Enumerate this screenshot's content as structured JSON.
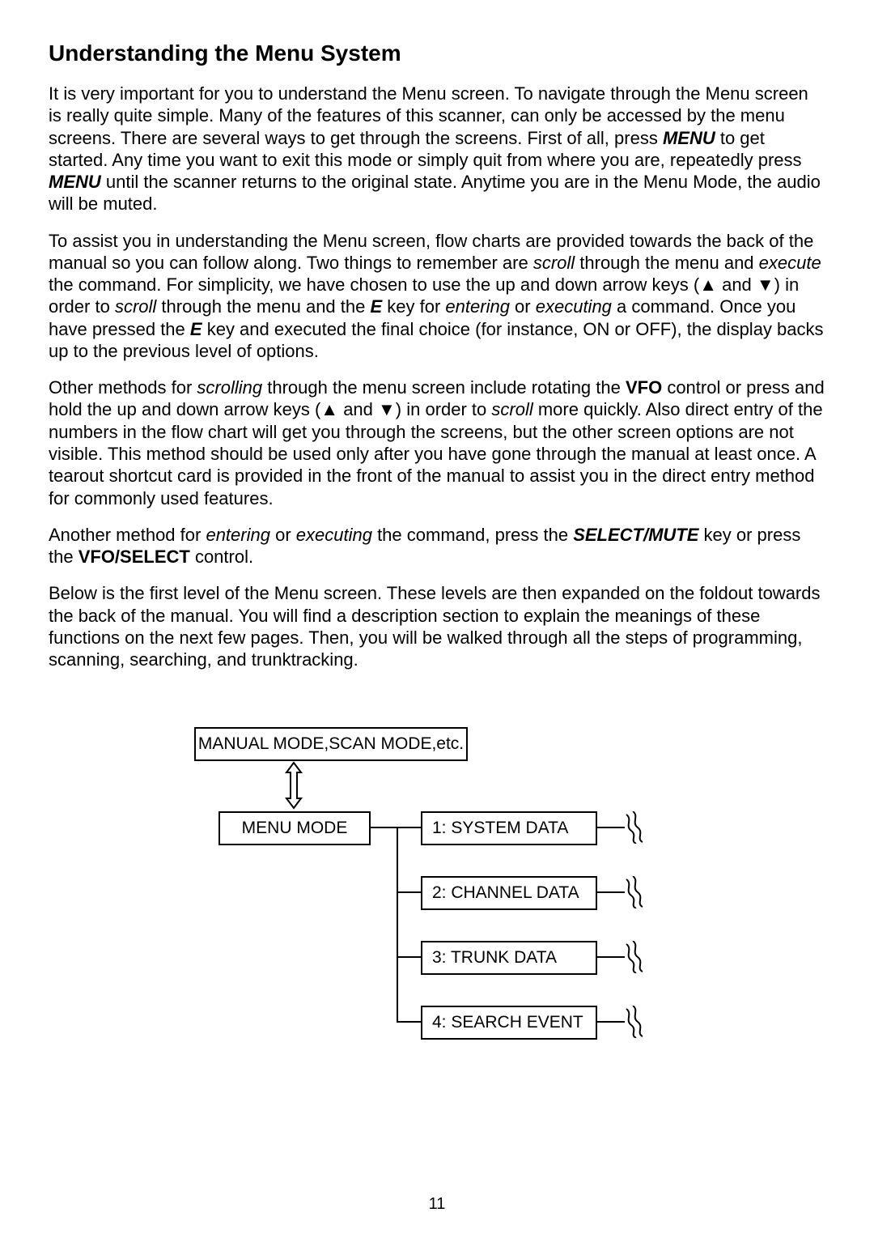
{
  "title": "Understanding the Menu System",
  "para1": {
    "t1": "It is very important for you to understand the Menu screen. To navigate through the Menu screen is really quite simple. Many of the features of this scanner, can only be accessed by the menu screens. There are several ways to get through the screens. First of all, press ",
    "menu1": "MENU",
    "t2": " to get started. Any time you want to exit this mode or simply quit from where you are, repeatedly press ",
    "menu2": "MENU",
    "t3": " until the scanner returns to the original state. Anytime you are in the Menu Mode, the audio will be muted."
  },
  "para2": {
    "t1": "To assist you in understanding the Menu screen, flow charts are provided towards the back of the manual so you can follow along. Two things to remember are ",
    "scroll1": "scroll",
    "t2": " through the menu and ",
    "execute1": "execute",
    "t3": " the command. For simplicity, we have chosen to use the up and down arrow keys (▲ and ▼) in order to ",
    "scroll2": "scroll",
    "t4": " through the menu and the ",
    "ekey": "E",
    "t5": " key for ",
    "entering": "entering",
    "t6": " or ",
    "executing": "executing",
    "t7": " a command. Once you have pressed the ",
    "ekey2": "E",
    "t8": " key and executed the final choice (for instance, ON or OFF), the display backs up to the previous level of options."
  },
  "para3": {
    "t1": "Other methods for ",
    "scrolling": "scrolling",
    "t2": " through the menu screen include rotating the ",
    "vfo": "VFO",
    "t3": " control or press and hold the up and down arrow keys (▲ and ▼) in order to ",
    "scroll": "scroll",
    "t4": " more quickly. Also direct entry of the numbers in the flow chart will get you through the screens, but the other screen options are not visible. This method should be used only after you have gone through the manual at least once. A tearout shortcut card is provided in the front of the manual to assist you in the direct entry method for commonly used features."
  },
  "para4": {
    "t1": "Another method for ",
    "entering": "entering",
    "t2": " or ",
    "executing": "executing",
    "t3": " the command, press the ",
    "selectmute": "SELECT/MUTE",
    "t4": " key or press the ",
    "vfoselect": "VFO/SELECT",
    "t5": " control."
  },
  "para5": "Below is the first level of the Menu screen. These levels are then expanded on the foldout towards the back of the manual. You will find a description section to explain the meanings of these functions on the next few pages. Then, you will be walked through all the steps of programming, scanning, searching, and trunktracking.",
  "diagram": {
    "top": "MANUAL MODE,SCAN MODE,etc.",
    "menu": "MENU MODE",
    "options": [
      "1: SYSTEM DATA",
      "2: CHANNEL DATA",
      "3: TRUNK DATA",
      "4: SEARCH EVENT"
    ]
  },
  "page_number": "11"
}
